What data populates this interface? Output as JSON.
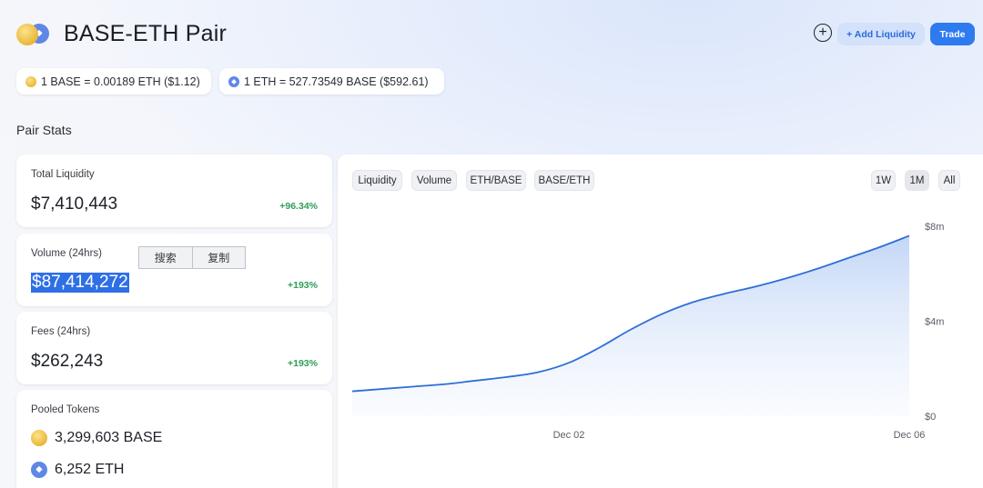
{
  "header": {
    "title": "BASE-ETH Pair",
    "add_liquidity_label": "+ Add Liquidity",
    "trade_label": "Trade",
    "plus_icon": "+"
  },
  "rates": {
    "base_to_eth": "1 BASE = 0.00189 ETH ($1.12)",
    "eth_to_base": "1 ETH = 527.73549 BASE ($592.61)"
  },
  "section_title": "Pair Stats",
  "stats": {
    "total_liquidity": {
      "label": "Total Liquidity",
      "value": "$7,410,443",
      "change": "+96.34%"
    },
    "volume": {
      "label": "Volume (24hrs)",
      "value": "$87,414,272",
      "change": "+193%"
    },
    "fees": {
      "label": "Fees (24hrs)",
      "value": "$262,243",
      "change": "+193%"
    },
    "pooled": {
      "label": "Pooled Tokens",
      "base": "3,299,603 BASE",
      "eth": "6,252 ETH"
    }
  },
  "context_menu": {
    "search": "搜索",
    "copy": "复制"
  },
  "chart_tabs": [
    "Liquidity",
    "Volume",
    "ETH/BASE",
    "BASE/ETH"
  ],
  "ranges": [
    "1W",
    "1M",
    "All"
  ],
  "selected_range": "1M",
  "colors": {
    "accent": "#2e7bf0",
    "positive": "#2f9e57",
    "selection": "#2f6fe6",
    "line": "#2f6fd6"
  },
  "chart_data": {
    "type": "area",
    "title": "",
    "xlabel": "",
    "ylabel": "",
    "x_tick_labels": [
      "Dec 02",
      "Dec 06"
    ],
    "y_tick_labels": [
      "$8m",
      "$4m",
      "$0"
    ],
    "ylim": [
      0,
      8000000
    ],
    "grid": false,
    "series": [
      {
        "values": [
          1050000,
          1150000,
          1250000,
          1350000,
          1500000,
          1650000,
          1850000,
          2250000,
          2900000,
          3650000,
          4300000,
          4800000,
          5150000,
          5450000,
          5800000,
          6200000,
          6650000,
          7100000,
          7600000
        ]
      }
    ]
  }
}
